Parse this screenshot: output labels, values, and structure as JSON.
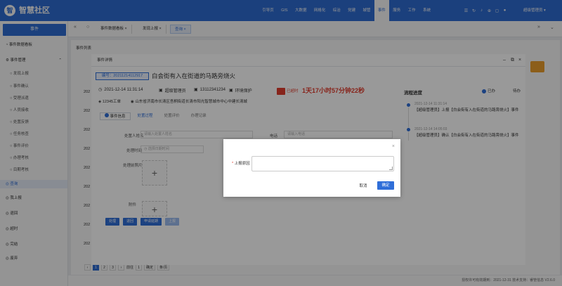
{
  "app": {
    "name": "智慧社区",
    "logo_char": "智"
  },
  "topnav": {
    "items": [
      "引导页",
      "GIS",
      "大数据",
      "网格化",
      "综治",
      "党建",
      "城管",
      "事件",
      "服务",
      "工作",
      "系统"
    ],
    "active_index": 7
  },
  "user": {
    "name": "超级管理员"
  },
  "sidebar": {
    "header": "事件",
    "items": [
      {
        "label": "事件数据看板",
        "type": "top",
        "icon": "chart-icon"
      },
      {
        "label": "事件管理",
        "type": "group",
        "icon": "gear-icon"
      },
      {
        "label": "发现上报",
        "type": "sub"
      },
      {
        "label": "事件确认",
        "type": "sub"
      },
      {
        "label": "受理派遣",
        "type": "sub"
      },
      {
        "label": "人员接收",
        "type": "sub"
      },
      {
        "label": "处置反馈",
        "type": "sub"
      },
      {
        "label": "任务核查",
        "type": "sub"
      },
      {
        "label": "事件评价",
        "type": "sub"
      },
      {
        "label": "办理考核",
        "type": "sub"
      },
      {
        "label": "目期考核",
        "type": "sub"
      },
      {
        "label": "查询",
        "type": "top",
        "active": true,
        "icon": "search-icon"
      },
      {
        "label": "我上报",
        "type": "top",
        "icon": "upload-icon"
      },
      {
        "label": "退回",
        "type": "top",
        "icon": "return-icon"
      },
      {
        "label": "超时",
        "type": "top",
        "icon": "clock-icon"
      },
      {
        "label": "完结",
        "type": "top",
        "icon": "check-icon"
      },
      {
        "label": "废弃",
        "type": "top",
        "icon": "trash-icon"
      }
    ]
  },
  "tabs": [
    {
      "label": "事件数据看板"
    },
    {
      "label": "发现上报"
    },
    {
      "label": "查询",
      "active": true
    }
  ],
  "background": {
    "list_title": "事件列表",
    "row_years": [
      "202",
      "202",
      "202",
      "202",
      "202",
      "202",
      "202",
      "202",
      "202"
    ],
    "pager": {
      "pages": [
        "1",
        "2",
        "3"
      ],
      "total_label": "前往",
      "page_input": "1",
      "confirm": "确定",
      "per_page": "条/页"
    }
  },
  "detail": {
    "title": "事件详情",
    "number": "编号：20211214112917",
    "event_title": "白会街有入在街道的马路旁烧火",
    "time": "2021-12-14 11:31:14",
    "reporter": "超级管理员",
    "phone": "13112341234",
    "category": "环境保护",
    "warn_label": "已超时",
    "countdown": "1天17小时57分钟22秒",
    "source": "12345工单",
    "address": "山东省济南市长清区吾桐街道长清市阳光智慧城市中心中建长清城",
    "process_tabs": [
      "事件信息",
      "处置过程",
      "处置评价",
      "办理记录"
    ],
    "form": {
      "name_label": "处置人姓名",
      "name_placeholder": "请输入处置人姓名",
      "phone_label": "电话",
      "phone_placeholder": "请输入电话",
      "time_label": "处理时间",
      "time_placeholder": "选择日期时间",
      "photo_label": "处理前照片",
      "after_label": "附件"
    },
    "buttons": [
      "处理",
      "退回",
      "申请延期",
      "上报"
    ],
    "progress": {
      "title": "流程进度",
      "done_label": "已办",
      "todo_label": "待办",
      "entries": [
        {
          "time": "2021-12-14 11:31:14",
          "text": "【超级管理员】上报【白会街有入在街道的马路旁烧火】事件"
        },
        {
          "time": "2021-12-14 14:05:03",
          "text": "【超级管理员】确认【白会街有入在街道的马路旁烧火】事件"
        }
      ]
    }
  },
  "dialog": {
    "label": "上报原因",
    "required_mark": "*",
    "value": "",
    "cancel": "取消",
    "ok": "确定"
  },
  "footer": {
    "text": "授权许可有效期到：2021-12-31  技术支持：睿管信息  V2.6.0"
  }
}
